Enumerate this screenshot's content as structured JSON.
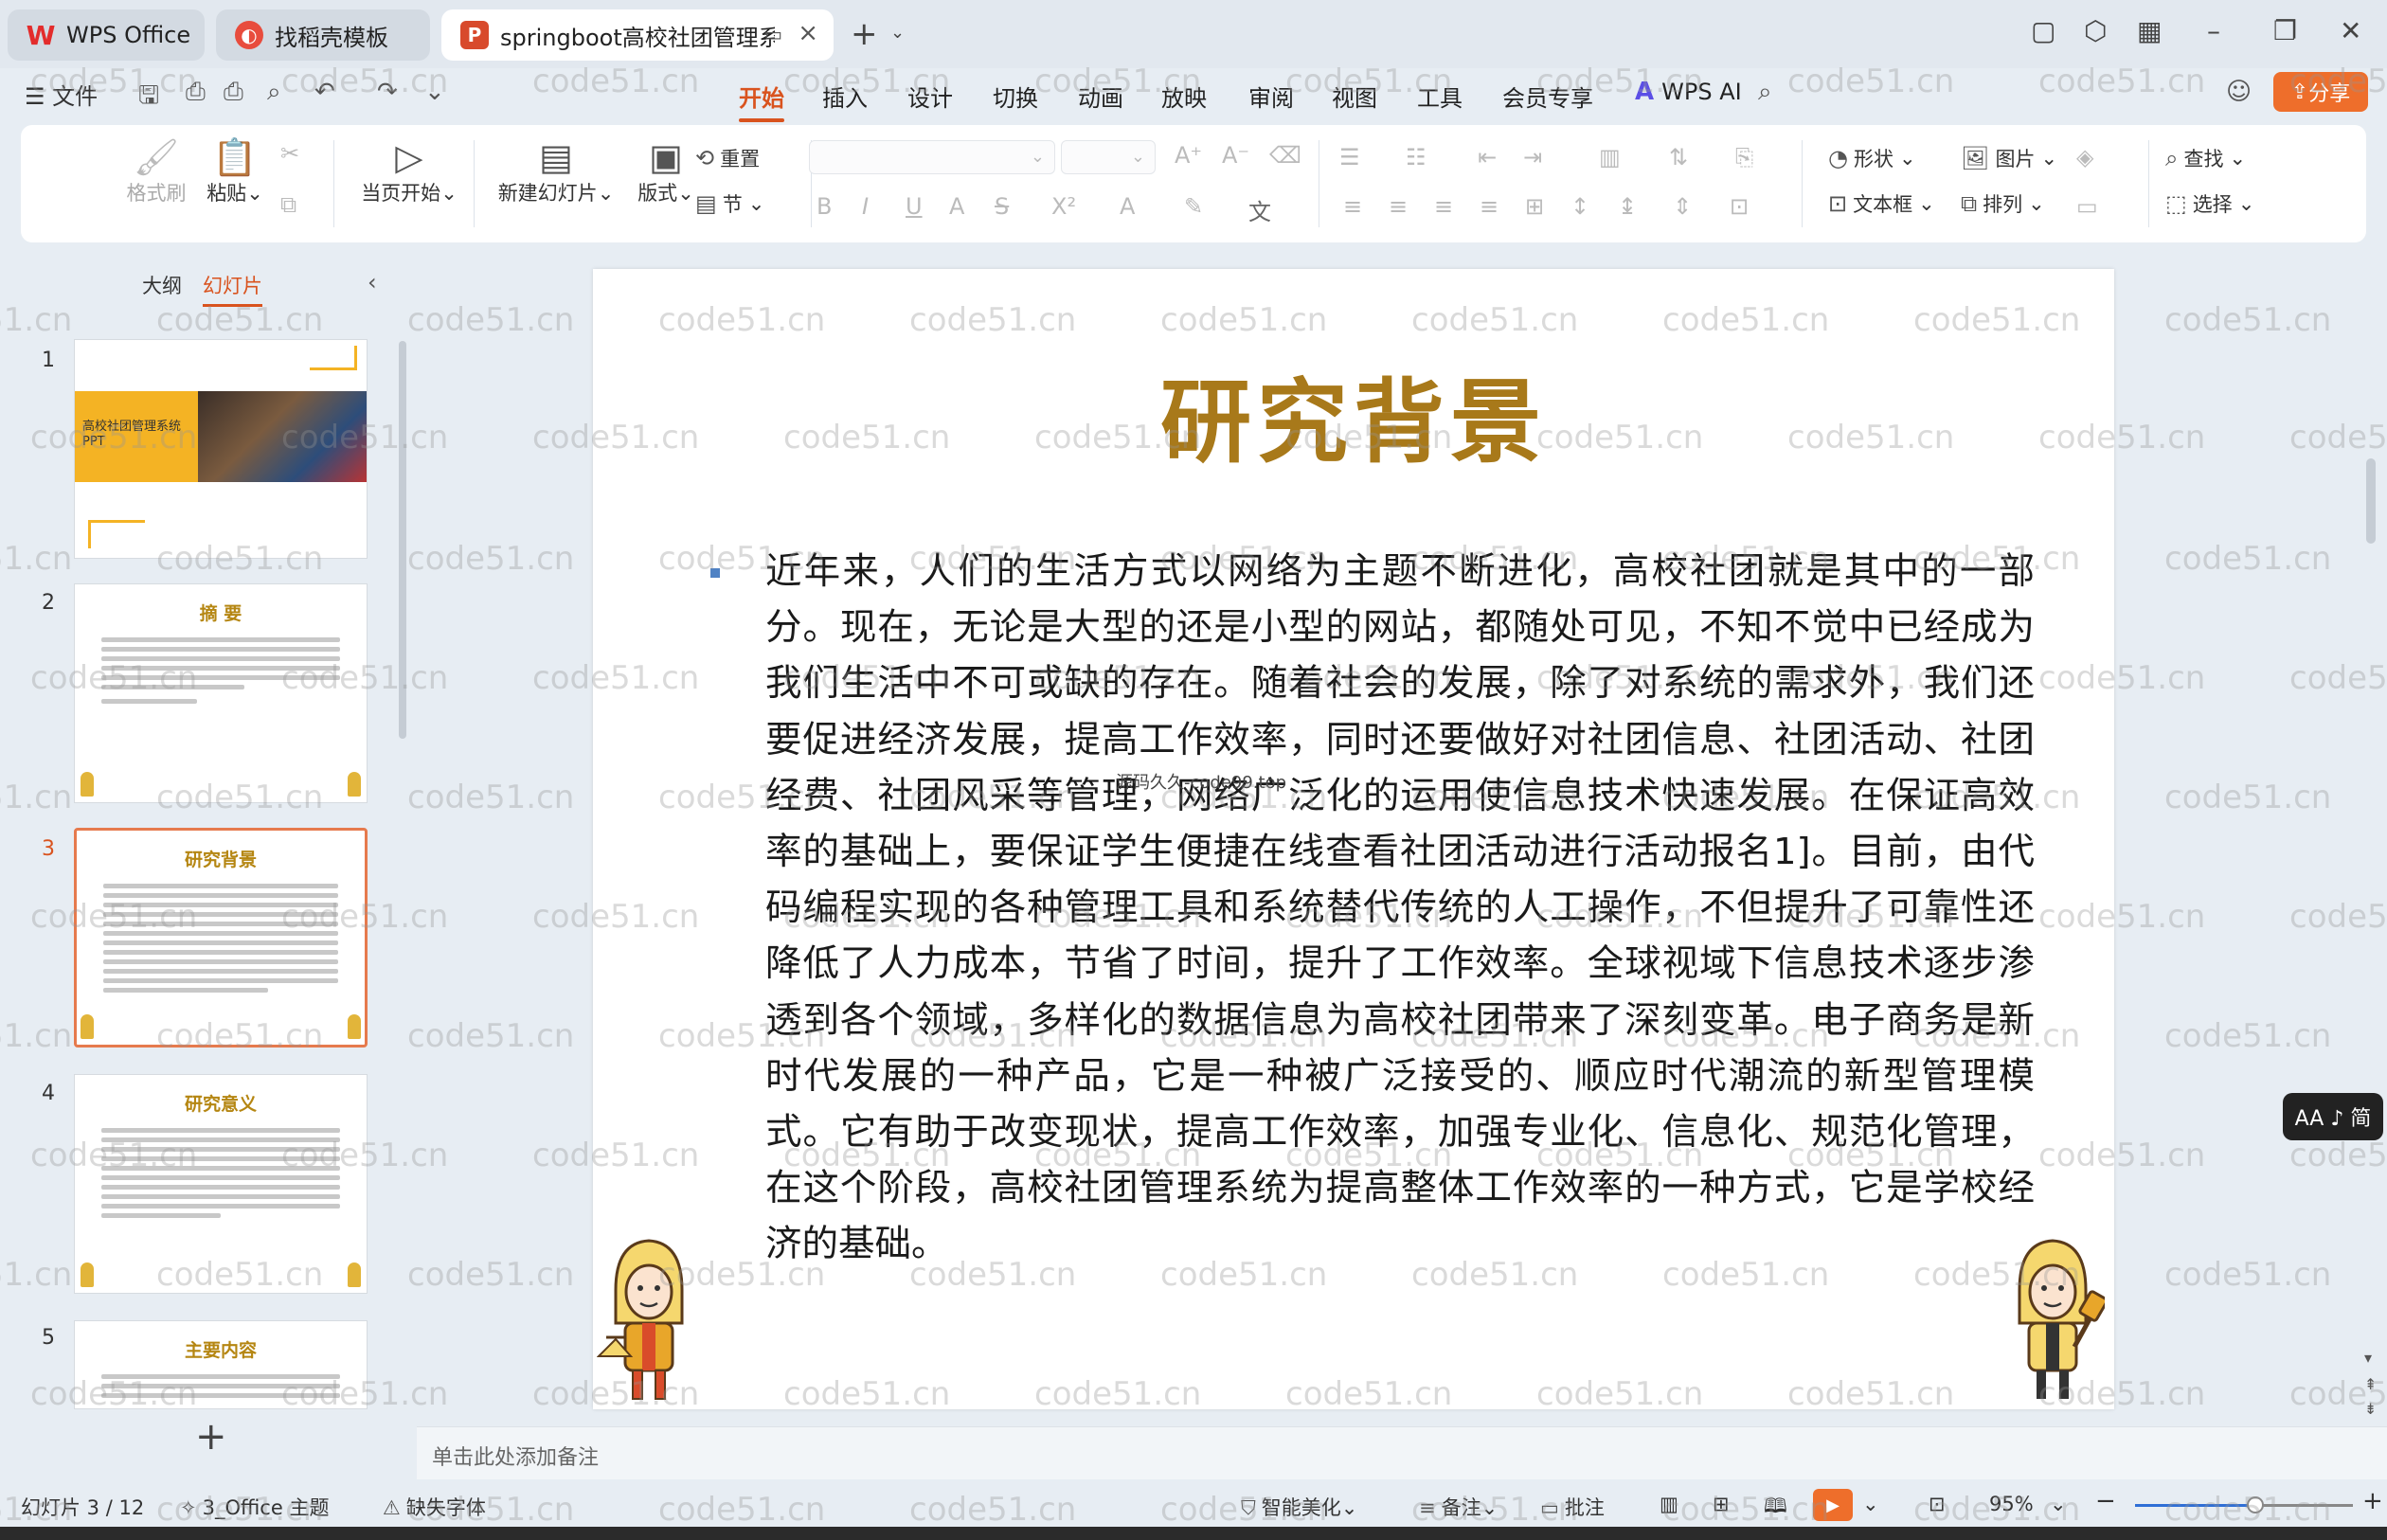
{
  "titlebar": {
    "tabs": [
      {
        "label": "WPS Office",
        "icon": "wps-logo-icon"
      },
      {
        "label": "找稻壳模板",
        "icon": "daoke-icon"
      },
      {
        "label": "springboot高校社团管理系统",
        "icon": "ppt-file-icon",
        "active": true
      }
    ]
  },
  "menu": {
    "file": "文件",
    "tabs": [
      "开始",
      "插入",
      "设计",
      "切换",
      "动画",
      "放映",
      "审阅",
      "视图",
      "工具",
      "会员专享"
    ],
    "active_tab": "开始",
    "wps_ai": "WPS AI",
    "share": "分享"
  },
  "ribbon": {
    "format_painter": "格式刷",
    "paste": "粘贴",
    "play_from_current": "当页开始",
    "new_slide": "新建幻灯片",
    "layout": "版式",
    "reset": "重置",
    "section": "节",
    "shape": "形状",
    "picture": "图片",
    "find": "查找",
    "textbox": "文本框",
    "arrange": "排列",
    "select": "选择"
  },
  "left_panel": {
    "tabs": [
      "大纲",
      "幻灯片"
    ],
    "active_tab": "幻灯片",
    "slides": [
      {
        "num": "1",
        "title": "高校社团管理系统 PPT"
      },
      {
        "num": "2",
        "title": "摘 要"
      },
      {
        "num": "3",
        "title": "研究背景",
        "active": true
      },
      {
        "num": "4",
        "title": "研究意义"
      },
      {
        "num": "5",
        "title": "主要内容"
      }
    ]
  },
  "slide": {
    "title": "研究背景",
    "body": "近年来，人们的生活方式以网络为主题不断进化，高校社团就是其中的一部分。现在，无论是大型的还是小型的网站，都随处可见，不知不觉中已经成为我们生活中不可或缺的存在。随着社会的发展，除了对系统的需求外，我们还要促进经济发展，提高工作效率，同时还要做好对社团信息、社团活动、社团经费、社团风采等管理，网络广泛化的运用使信息技术快速发展。在保证高效率的基础上，要保证学生便捷在线查看社团活动进行活动报名1]。目前，由代码编程实现的各种管理工具和系统替代传统的人工操作，不但提升了可靠性还降低了人力成本，节省了时间，提升了工作效率。全球视域下信息技术逐步渗透到各个领域，多样化的数据信息为高校社团带来了深刻变革。电子商务是新时代发展的一种产品，它是一种被广泛接受的、顺应时代潮流的新型管理模式。它有助于改变现状，提高工作效率，加强专业化、信息化、规范化管理，在这个阶段，高校社团管理系统为提高整体工作效率的一种方式，它是学校经济的基础。",
    "overlay_watermark": "源码久久-code99.top"
  },
  "aa_button": "AA ♪ 简",
  "notes_placeholder": "单击此处添加备注",
  "status": {
    "slide_counter": "幻灯片 3 / 12",
    "theme": "3_Office 主题",
    "missing_font": "缺失字体",
    "smart_beautify": "智能美化",
    "notes": "备注",
    "comments": "批注",
    "zoom": "95%",
    "zoom_fraction": 0.55
  },
  "watermark": "code51.cn"
}
